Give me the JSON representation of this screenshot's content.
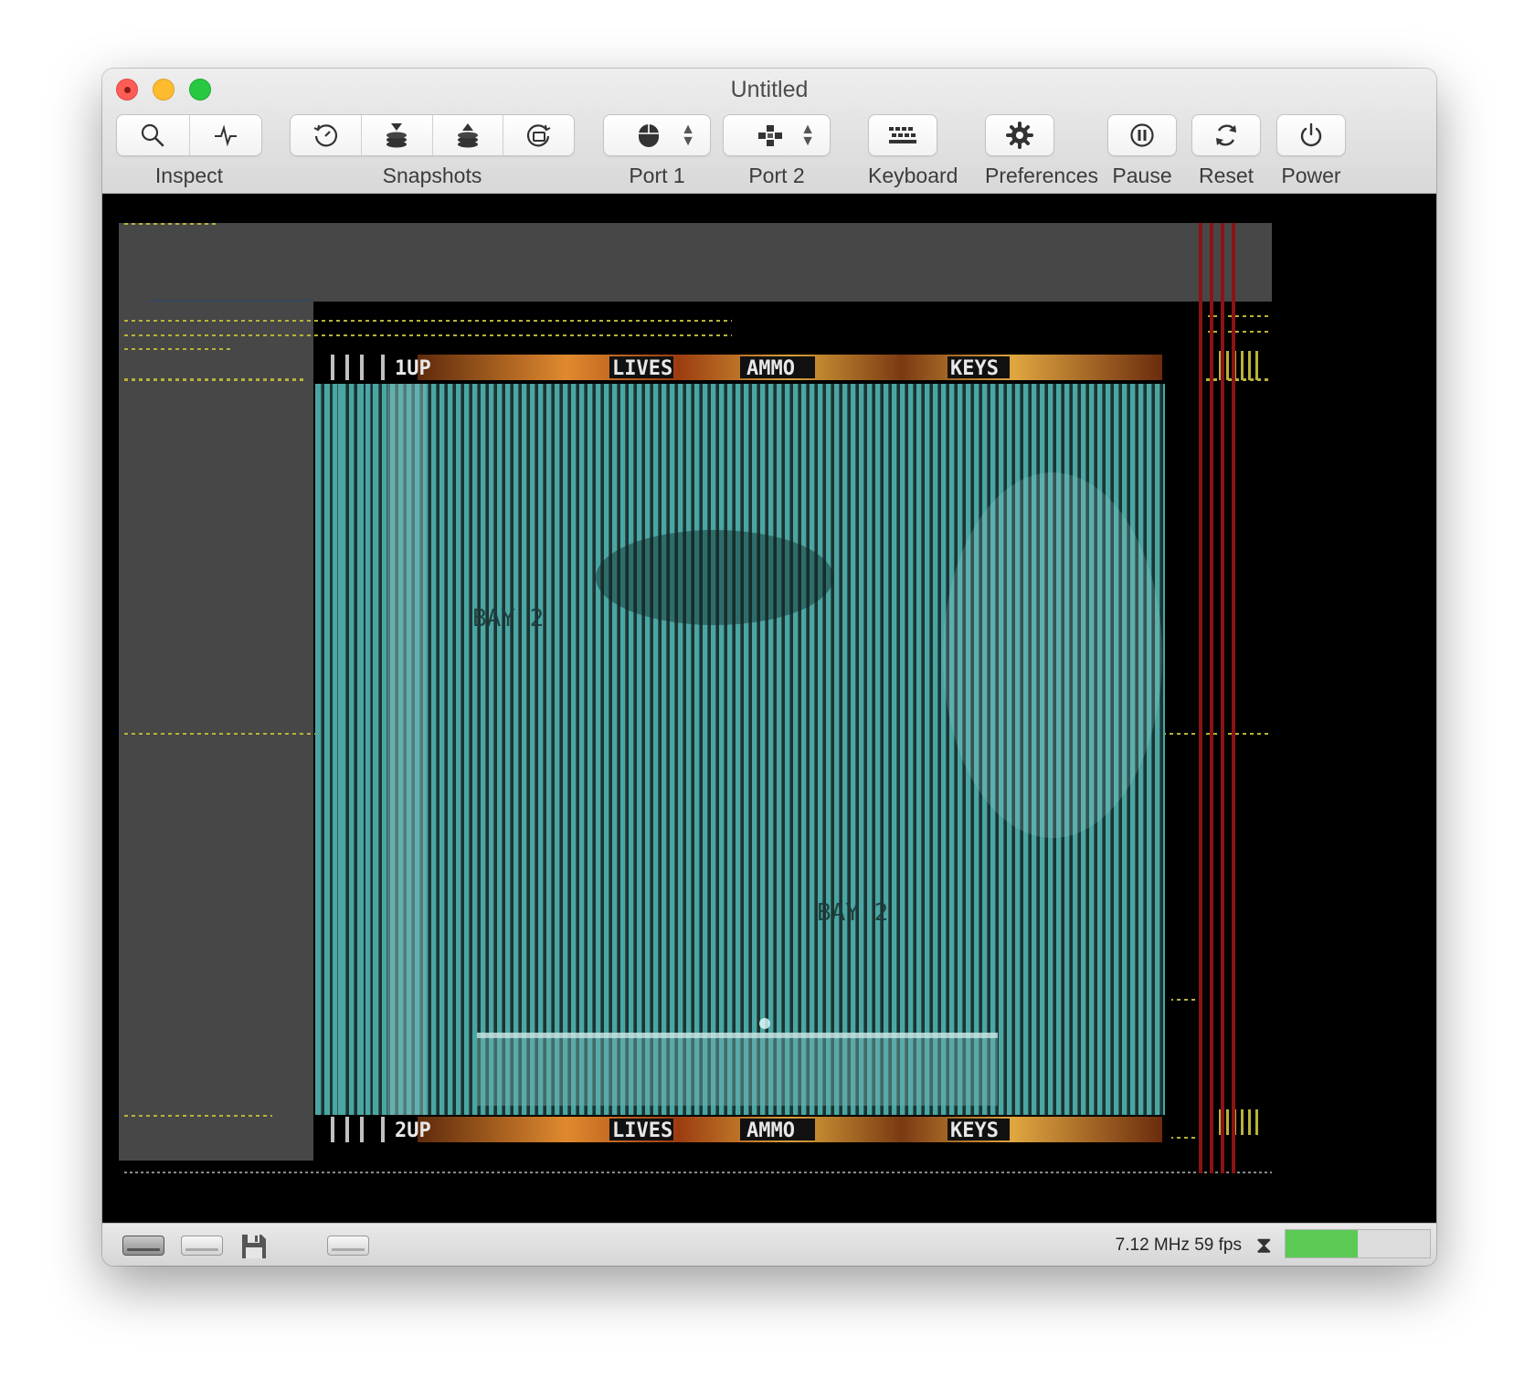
{
  "window": {
    "title": "Untitled"
  },
  "toolbar": {
    "inspect_label": "Inspect",
    "snapshots_label": "Snapshots",
    "port1_label": "Port 1",
    "port2_label": "Port 2",
    "keyboard_label": "Keyboard",
    "preferences_label": "Preferences",
    "pause_label": "Pause",
    "reset_label": "Reset",
    "power_label": "Power",
    "icons": {
      "inspect": [
        "magnifier-icon",
        "pulse-icon"
      ],
      "snapshots": [
        "rewind-clock-icon",
        "stack-down-icon",
        "stack-up-icon",
        "restore-clock-icon"
      ],
      "port1": "mouse-icon",
      "port2": "joystick-icon",
      "keyboard": "keyboard-icon",
      "preferences": "gear-icon",
      "pause": "pause-icon",
      "reset": "reset-icon",
      "power": "power-icon"
    }
  },
  "emulator": {
    "hud_top": {
      "player": "1UP",
      "lives": "LIVES",
      "ammo": "AMMO",
      "keys": "KEYS"
    },
    "hud_bottom": {
      "player": "2UP",
      "lives": "LIVES",
      "ammo": "AMMO",
      "keys": "KEYS"
    },
    "game_text": [
      "BAY 2",
      "BAY 2"
    ],
    "colors": {
      "border": "#474747",
      "playfield": "#3b8a88",
      "hud": "#c07a26",
      "raster": "#8a1414",
      "dots": "#b8b33a"
    }
  },
  "status": {
    "drives": [
      "drive-icon",
      "drive-icon",
      "floppy-icon",
      "drive-icon"
    ],
    "text": "7.12 MHz 59 fps",
    "hourglass_icon": "hourglass-icon",
    "performance": 0.5,
    "performance_color": "#5bca55"
  }
}
